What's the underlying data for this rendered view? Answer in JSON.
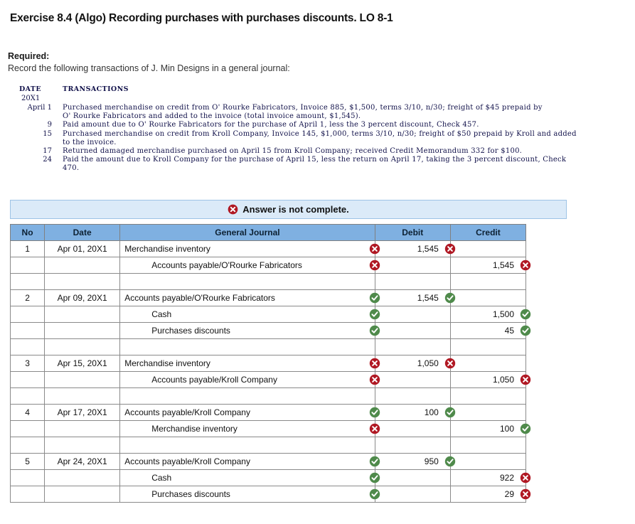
{
  "exercise": {
    "title": "Exercise 8.4 (Algo) Recording purchases with purchases discounts. LO 8-1",
    "required_label": "Required:",
    "required_text": "Record the following transactions of J. Min Designs in a general journal:"
  },
  "transactions": {
    "header": {
      "date": "DATE",
      "transactions": "TRANSACTIONS"
    },
    "year": "20X1",
    "rows": [
      {
        "date": "April 1",
        "lines": [
          "Purchased merchandise on credit from O' Rourke Fabricators, Invoice 885, $1,500, terms 3/10, n/30; freight of $45 prepaid by",
          "O' Rourke Fabricators and added to the invoice (total invoice amount, $1,545)."
        ]
      },
      {
        "date": "9",
        "lines": [
          "Paid amount due to O' Rourke Fabricators for the purchase of April 1, less the 3 percent discount, Check 457."
        ]
      },
      {
        "date": "15",
        "lines": [
          "Purchased merchandise on credit from Kroll Company, Invoice 145, $1,000, terms 3/10, n/30; freight of $50 prepaid by Kroll and added",
          "to the invoice."
        ]
      },
      {
        "date": "17",
        "lines": [
          "Returned damaged merchandise purchased on April 15 from Kroll Company; received Credit Memorandum 332 for $100."
        ]
      },
      {
        "date": "24",
        "lines": [
          "Paid the amount due to Kroll Company for the purchase of April 15, less the return on April 17, taking the 3 percent discount, Check",
          "470."
        ]
      }
    ]
  },
  "banner": {
    "icon": "error-x-icon",
    "text": "Answer is not complete."
  },
  "journal": {
    "columns": {
      "no": "No",
      "date": "Date",
      "general_journal": "General Journal",
      "debit": "Debit",
      "credit": "Credit"
    },
    "entries": [
      {
        "no": "1",
        "date": "Apr 01, 20X1",
        "lines": [
          {
            "account": "Merchandise inventory",
            "indent": false,
            "account_status": "wrong",
            "debit": "1,545",
            "debit_status": "wrong",
            "credit": "",
            "credit_status": "none"
          },
          {
            "account": "Accounts payable/O'Rourke Fabricators",
            "indent": true,
            "account_status": "wrong",
            "debit": "",
            "debit_status": "none",
            "credit": "1,545",
            "credit_status": "wrong"
          }
        ]
      },
      {
        "no": "2",
        "date": "Apr 09, 20X1",
        "lines": [
          {
            "account": "Accounts payable/O'Rourke Fabricators",
            "indent": false,
            "account_status": "right",
            "debit": "1,545",
            "debit_status": "right",
            "credit": "",
            "credit_status": "none"
          },
          {
            "account": "Cash",
            "indent": true,
            "account_status": "right",
            "debit": "",
            "debit_status": "none",
            "credit": "1,500",
            "credit_status": "right"
          },
          {
            "account": "Purchases discounts",
            "indent": true,
            "account_status": "right",
            "debit": "",
            "debit_status": "none",
            "credit": "45",
            "credit_status": "right"
          }
        ]
      },
      {
        "no": "3",
        "date": "Apr 15, 20X1",
        "lines": [
          {
            "account": "Merchandise inventory",
            "indent": false,
            "account_status": "wrong",
            "debit": "1,050",
            "debit_status": "wrong",
            "credit": "",
            "credit_status": "none"
          },
          {
            "account": "Accounts payable/Kroll Company",
            "indent": true,
            "account_status": "wrong",
            "debit": "",
            "debit_status": "none",
            "credit": "1,050",
            "credit_status": "wrong"
          }
        ]
      },
      {
        "no": "4",
        "date": "Apr 17, 20X1",
        "lines": [
          {
            "account": "Accounts payable/Kroll Company",
            "indent": false,
            "account_status": "right",
            "debit": "100",
            "debit_status": "right",
            "credit": "",
            "credit_status": "none"
          },
          {
            "account": "Merchandise inventory",
            "indent": true,
            "account_status": "wrong",
            "debit": "",
            "debit_status": "none",
            "credit": "100",
            "credit_status": "right"
          }
        ]
      },
      {
        "no": "5",
        "date": "Apr 24, 20X1",
        "lines": [
          {
            "account": "Accounts payable/Kroll Company",
            "indent": false,
            "account_status": "right",
            "debit": "950",
            "debit_status": "right",
            "credit": "",
            "credit_status": "none"
          },
          {
            "account": "Cash",
            "indent": true,
            "account_status": "right",
            "debit": "",
            "debit_status": "none",
            "credit": "922",
            "credit_status": "wrong"
          },
          {
            "account": "Purchases discounts",
            "indent": true,
            "account_status": "right",
            "debit": "",
            "debit_status": "none",
            "credit": "29",
            "credit_status": "wrong"
          }
        ]
      }
    ]
  },
  "colors": {
    "header_blue": "#7fb0e1",
    "banner_blue": "#dbeaf8",
    "wrong_red": "#b01823",
    "right_green": "#4f8a4b",
    "wrong_tint": "#fdf0f0",
    "right_tint": "#f4f8f2"
  }
}
